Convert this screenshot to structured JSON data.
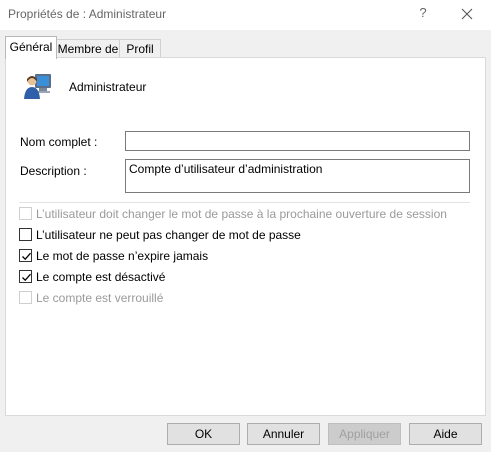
{
  "window": {
    "title": "Propriétés de : Administrateur",
    "help_label": "?",
    "close_icon": "close-icon"
  },
  "tabs": [
    {
      "label": "Général",
      "active": true
    },
    {
      "label": "Membre de",
      "active": false
    },
    {
      "label": "Profil",
      "active": false
    }
  ],
  "user": {
    "icon": "user-monitor-icon",
    "name": "Administrateur"
  },
  "fields": {
    "fullname_label": "Nom complet :",
    "fullname_value": "",
    "description_label": "Description :",
    "description_value": "Compte d’utilisateur d’administration"
  },
  "checkboxes": [
    {
      "label": "L’utilisateur doit changer le mot de passe à la prochaine ouverture de session",
      "checked": false,
      "enabled": false
    },
    {
      "label": "L’utilisateur ne peut pas changer de mot de passe",
      "checked": false,
      "enabled": true
    },
    {
      "label": "Le mot de passe n’expire jamais",
      "checked": true,
      "enabled": true
    },
    {
      "label": "Le compte est désactivé",
      "checked": true,
      "enabled": true
    },
    {
      "label": "Le compte est verrouillé",
      "checked": false,
      "enabled": false
    }
  ],
  "buttons": {
    "ok": "OK",
    "cancel": "Annuler",
    "apply": "Appliquer",
    "help": "Aide"
  }
}
